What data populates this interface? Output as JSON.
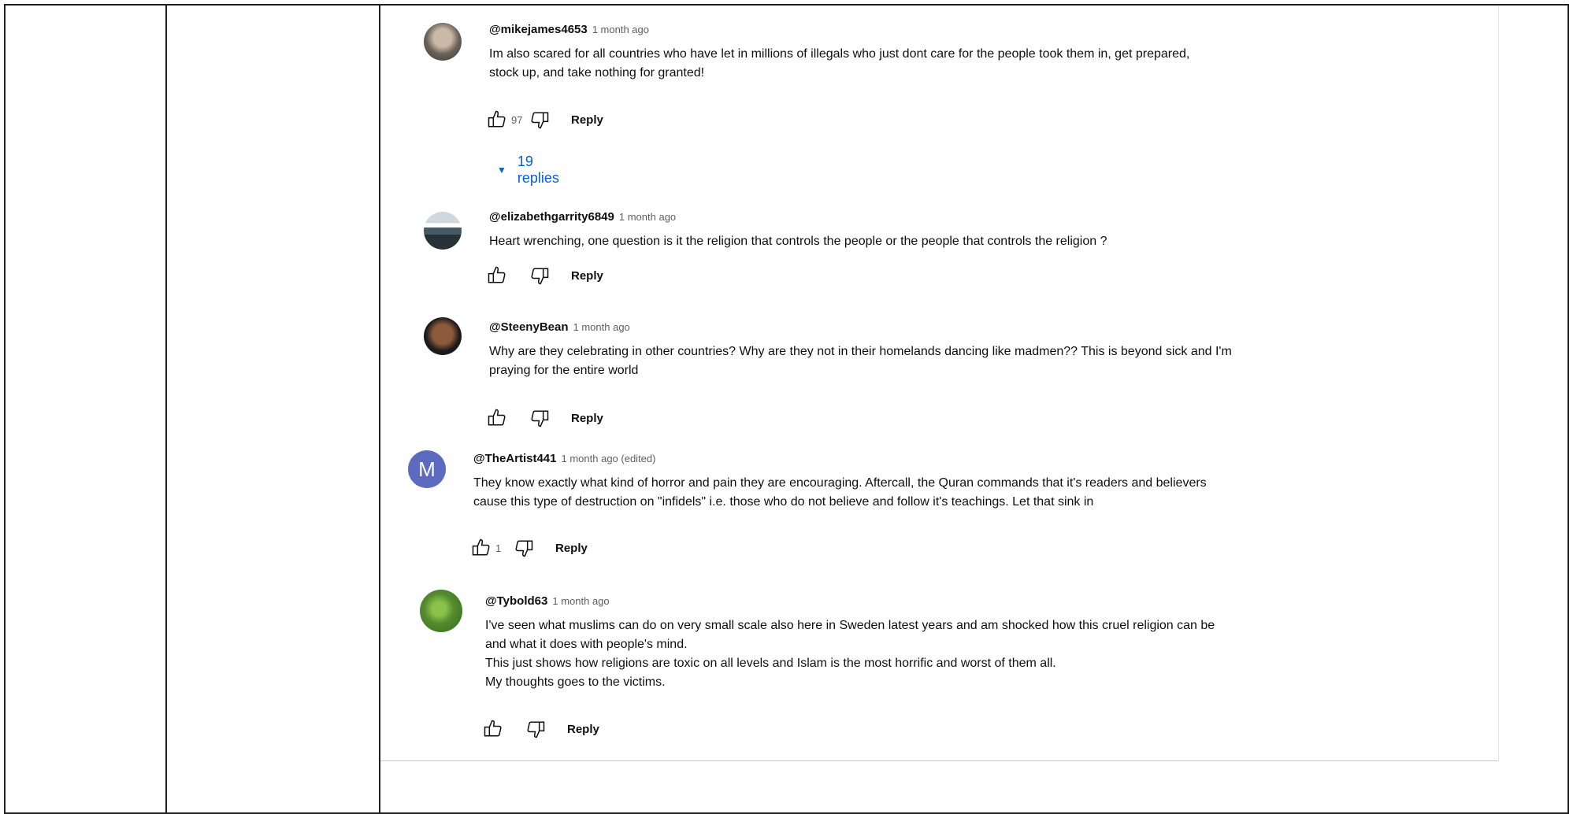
{
  "comments": [
    {
      "author": "@mikejames4653",
      "meta": "1 month ago",
      "lines": [
        "Im also scared for all countries who have let in  millions of illegals who just dont care for the people took them in, get prepared,",
        "stock up, and take nothing for granted!"
      ],
      "likes": "97",
      "reply_label": "Reply",
      "replies_label": "19 replies"
    },
    {
      "author": "@elizabethgarrity6849",
      "meta": "1 month ago",
      "lines": [
        "Heart wrenching, one question is it the religion  that controls the people or the people that controls the religion ?"
      ],
      "likes": "",
      "reply_label": "Reply"
    },
    {
      "author": "@SteenyBean",
      "meta": "1 month ago",
      "lines": [
        "Why are they celebrating in other countries? Why are they not in their homelands dancing like madmen?? This is beyond sick and I'm",
        "praying for the entire world"
      ],
      "likes": "",
      "reply_label": "Reply"
    },
    {
      "author": "@TheArtist441",
      "meta": "1 month ago (edited)",
      "avatar_letter": "M",
      "lines": [
        "They know exactly what kind of horror and pain they are encouraging. Aftercall, the Quran commands that it's readers and believers",
        "cause this type of destruction on \"infidels\" i.e. those who do not believe and follow it's teachings. Let that sink in"
      ],
      "likes": "1",
      "reply_label": "Reply"
    },
    {
      "author": "@Tybold63",
      "meta": "1 month ago",
      "lines": [
        "I've seen what muslims can do on very small scale also here in Sweden latest years and am shocked how this cruel religion can be",
        "and what it does with people's mind.",
        "This just shows how religions are toxic on all levels and Islam is the most horrific and worst of them all.",
        "My thoughts goes to the victims."
      ],
      "likes": "",
      "reply_label": "Reply"
    }
  ],
  "colors": {
    "link_blue": "#065fd4",
    "avatar_m_bg": "#5c6bc0",
    "meta_gray": "#606060"
  },
  "icons": [
    "thumb-up-icon",
    "thumb-down-icon",
    "caret-down-icon"
  ]
}
